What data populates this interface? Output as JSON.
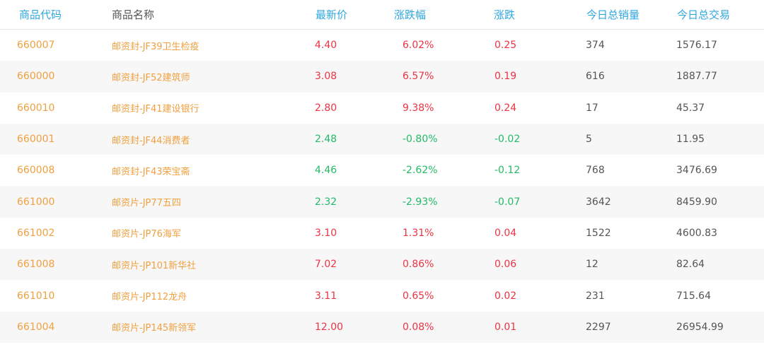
{
  "header": {
    "code": "商品代码",
    "name": "商品名称",
    "price": "最新价",
    "pct": "涨跌幅",
    "chg": "涨跌",
    "volume": "今日总销量",
    "amount": "今日总交易"
  },
  "colors": {
    "header_blue": "#2fa7e0",
    "orange": "#f0a040",
    "up_red": "#ee3344",
    "down_green": "#22bb66",
    "gray_text": "#555555",
    "stripe": "#f7f7f7"
  },
  "rows": [
    {
      "code": "660007",
      "name": "邮资封-JF39卫生检疫",
      "price": "4.40",
      "pct": "6.02%",
      "chg": "0.25",
      "volume": "374",
      "amount": "1576.17",
      "dir": "up"
    },
    {
      "code": "660000",
      "name": "邮资封-JF52建筑师",
      "price": "3.08",
      "pct": "6.57%",
      "chg": "0.19",
      "volume": "616",
      "amount": "1887.77",
      "dir": "up"
    },
    {
      "code": "660010",
      "name": "邮资封-JF41建设银行",
      "price": "2.80",
      "pct": "9.38%",
      "chg": "0.24",
      "volume": "17",
      "amount": "45.37",
      "dir": "up"
    },
    {
      "code": "660001",
      "name": "邮资封-JF44消费者",
      "price": "2.48",
      "pct": "-0.80%",
      "chg": "-0.02",
      "volume": "5",
      "amount": "11.95",
      "dir": "down"
    },
    {
      "code": "660008",
      "name": "邮资封-JF43荣宝斋",
      "price": "4.46",
      "pct": "-2.62%",
      "chg": "-0.12",
      "volume": "768",
      "amount": "3476.69",
      "dir": "down"
    },
    {
      "code": "661000",
      "name": "邮资片-JP77五四",
      "price": "2.32",
      "pct": "-2.93%",
      "chg": "-0.07",
      "volume": "3642",
      "amount": "8459.90",
      "dir": "down"
    },
    {
      "code": "661002",
      "name": "邮资片-JP76海军",
      "price": "3.10",
      "pct": "1.31%",
      "chg": "0.04",
      "volume": "1522",
      "amount": "4600.83",
      "dir": "up"
    },
    {
      "code": "661008",
      "name": "邮资片-JP101新华社",
      "price": "7.02",
      "pct": "0.86%",
      "chg": "0.06",
      "volume": "12",
      "amount": "82.64",
      "dir": "up"
    },
    {
      "code": "661010",
      "name": "邮资片-JP112龙舟",
      "price": "3.11",
      "pct": "0.65%",
      "chg": "0.02",
      "volume": "231",
      "amount": "715.64",
      "dir": "up"
    },
    {
      "code": "661004",
      "name": "邮资片-JP145新领军",
      "price": "12.00",
      "pct": "0.08%",
      "chg": "0.01",
      "volume": "2297",
      "amount": "26954.99",
      "dir": "up"
    }
  ]
}
